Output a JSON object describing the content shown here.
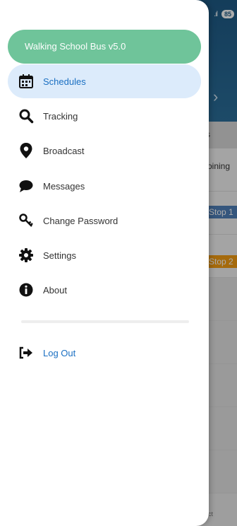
{
  "background": {
    "status": {
      "signal": ".ıl",
      "battery": "85"
    },
    "subheader_text": "s",
    "joining_text": "oining",
    "stops": [
      "Stop 1",
      "Stop 2"
    ],
    "footer_text": "ect"
  },
  "drawer": {
    "app_title": "Walking School Bus  v5.0",
    "items": [
      {
        "label": "Schedules",
        "icon": "calendar-icon",
        "active": true
      },
      {
        "label": "Tracking",
        "icon": "search-icon"
      },
      {
        "label": "Broadcast",
        "icon": "map-pin-icon"
      },
      {
        "label": "Messages",
        "icon": "chat-bubble-icon"
      },
      {
        "label": "Change Password",
        "icon": "key-icon"
      },
      {
        "label": "Settings",
        "icon": "gear-icon"
      },
      {
        "label": "About",
        "icon": "info-icon"
      }
    ],
    "logout": {
      "label": "Log Out",
      "icon": "logout-icon"
    }
  },
  "colors": {
    "accent": "#1a6fc2",
    "pill": "#6fc49a",
    "active_bg": "#dcebfb"
  }
}
